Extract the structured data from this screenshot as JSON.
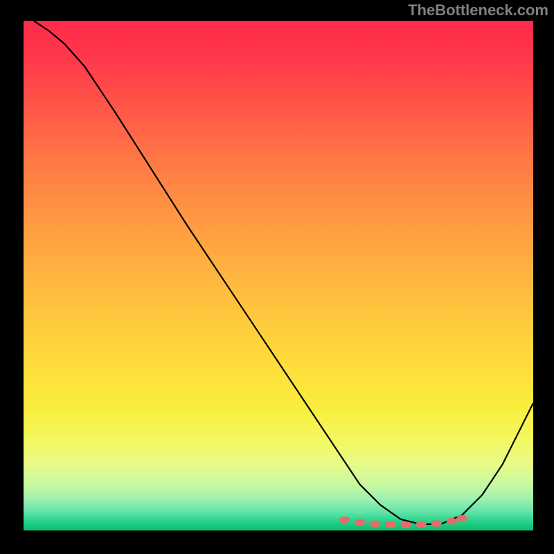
{
  "watermark": "TheBottleneck.com",
  "chart_data": {
    "type": "line",
    "title": "",
    "xlabel": "",
    "ylabel": "",
    "xlim": [
      0,
      100
    ],
    "ylim": [
      0,
      100
    ],
    "series": [
      {
        "name": "curve",
        "x": [
          2,
          5,
          8,
          12,
          18,
          25,
          32,
          40,
          48,
          56,
          62,
          66,
          70,
          74,
          78,
          82,
          86,
          90,
          94,
          98,
          100
        ],
        "y": [
          100,
          98,
          95.5,
          91,
          82,
          71,
          60,
          48,
          36,
          24,
          15,
          9,
          5,
          2.2,
          1.2,
          1.3,
          3,
          7,
          13,
          21,
          25
        ]
      },
      {
        "name": "highlighted-bottom",
        "x": [
          63,
          66,
          69,
          72,
          75,
          78,
          81,
          84,
          86
        ],
        "y": [
          2.1,
          1.6,
          1.3,
          1.15,
          1.1,
          1.15,
          1.35,
          1.8,
          2.4
        ]
      }
    ],
    "colors": {
      "curve": "#000000",
      "highlight": "#e86a6a",
      "gradient_top": "#ff2a4a",
      "gradient_mid": "#ffde3c",
      "gradient_bottom": "#0cbf6e"
    }
  }
}
